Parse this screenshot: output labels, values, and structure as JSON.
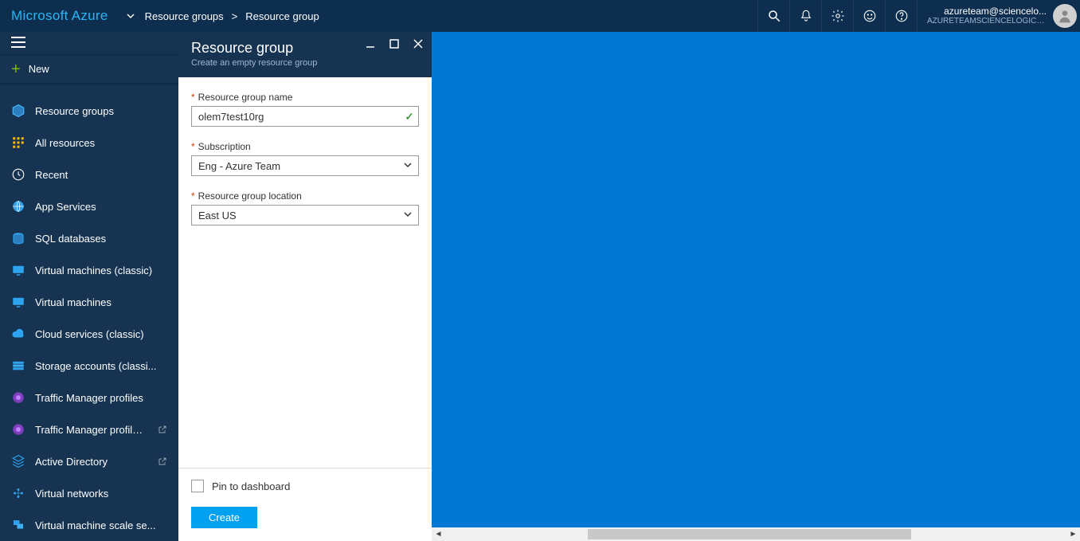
{
  "brand": "Microsoft Azure",
  "breadcrumb": {
    "items": [
      "Resource groups",
      "Resource group"
    ]
  },
  "user": {
    "email": "azureteam@sciencelo...",
    "tenant": "AZURETEAMSCIENCELOGIC (D..."
  },
  "sidebar": {
    "new_label": "New",
    "items": [
      {
        "label": "Resource groups",
        "icon": "cube-icon"
      },
      {
        "label": "All resources",
        "icon": "grid-icon"
      },
      {
        "label": "Recent",
        "icon": "clock-icon"
      },
      {
        "label": "App Services",
        "icon": "globe-icon"
      },
      {
        "label": "SQL databases",
        "icon": "sql-icon"
      },
      {
        "label": "Virtual machines (classic)",
        "icon": "vm-icon"
      },
      {
        "label": "Virtual machines",
        "icon": "vm-icon"
      },
      {
        "label": "Cloud services (classic)",
        "icon": "cloud-icon"
      },
      {
        "label": "Storage accounts (classi...",
        "icon": "storage-icon"
      },
      {
        "label": "Traffic Manager profiles",
        "icon": "traffic-icon"
      },
      {
        "label": "Traffic Manager profiles...",
        "icon": "traffic-icon",
        "external": true
      },
      {
        "label": "Active Directory",
        "icon": "ad-icon",
        "external": true
      },
      {
        "label": "Virtual networks",
        "icon": "vnet-icon"
      },
      {
        "label": "Virtual machine scale se...",
        "icon": "vmss-icon"
      }
    ]
  },
  "blade": {
    "title": "Resource group",
    "subtitle": "Create an empty resource group",
    "fields": {
      "name_label": "Resource group name",
      "name_value": "olem7test10rg",
      "subscription_label": "Subscription",
      "subscription_value": "Eng - Azure Team",
      "location_label": "Resource group location",
      "location_value": "East US"
    },
    "footer": {
      "pin_label": "Pin to dashboard",
      "create_label": "Create"
    }
  }
}
